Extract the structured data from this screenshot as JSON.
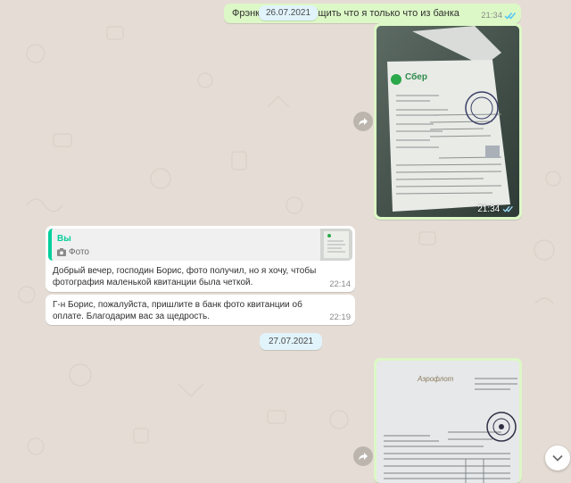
{
  "colors": {
    "chat_bg": "#e5ddd5",
    "outgoing": "#dcf8c6",
    "incoming": "#ffffff",
    "date_chip": "#e1f3fb",
    "quote_accent": "#06cf9c",
    "read_ticks": "#4fc3f7"
  },
  "messages": {
    "msg1": {
      "text": "Фрэнк, я тебе сообщить что я только что из банка",
      "time": "21:34",
      "status": "read"
    },
    "floating_date": "26.07.2021",
    "photo1": {
      "time": "21:34",
      "logo_text": "Сбер",
      "status": "read"
    },
    "msg2": {
      "quote_author": "Вы",
      "quote_icon": "camera-icon",
      "quote_type": "Фото",
      "text": "Добрый вечер, господин Борис, фото получил,  но я хочу, чтобы фотография маленькой квитанции была четкой.",
      "time": "22:14"
    },
    "msg3": {
      "text": "Г-н Борис, пожалуйста, пришлите в банк фото квитанции об оплате. Благодарим вас за щедрость.",
      "time": "22:19"
    },
    "date2": "27.07.2021",
    "photo2": {
      "logo_text": "Аэрофлот"
    }
  },
  "icons": {
    "forward": "forward-icon",
    "scroll_down": "chevron-down-icon"
  }
}
